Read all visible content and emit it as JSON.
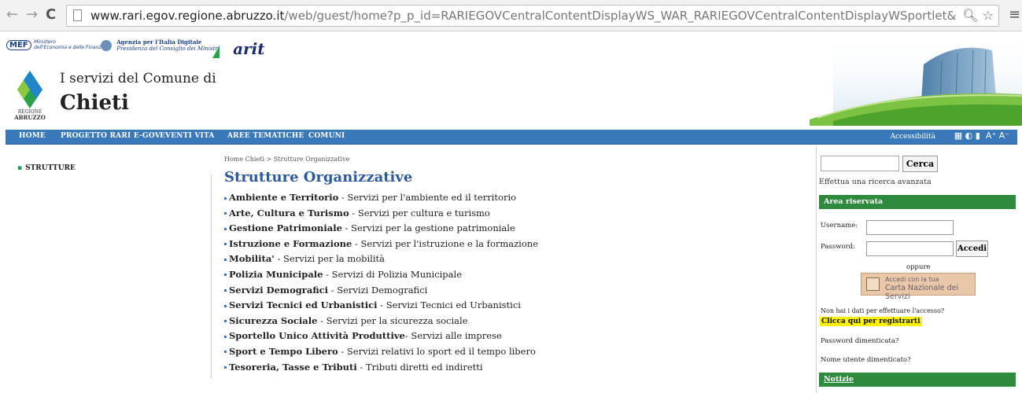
{
  "browser": {
    "url_host": "www.rari.egov.regione.abruzzo.it",
    "url_rest": "/web/guest/home?p_p_id=RARIEGOVCentralContentDisplayWS_WAR_RARIEGOVCentralContentDisplayWSportlet&p_p_life"
  },
  "logos": {
    "mef": "MEF",
    "mef_text_1": "Ministero",
    "mef_text_2": "dell'Economia e delle Finanze",
    "agid_1": "Agenzia per l'Italia Digitale",
    "agid_2": "Presidenza del Consiglio dei Ministri",
    "arit": "arit",
    "region_1": "REGIONE",
    "region_2": "ABRUZZO"
  },
  "header": {
    "subtitle": "I servizi del Comune di",
    "title": "Chieti"
  },
  "nav": {
    "items": [
      "HOME",
      "PROGETTO RARI E-GOV",
      "EVENTI VITA",
      "AREE TEMATICHE",
      "COMUNI"
    ],
    "accessibility": "Accessibilità",
    "font_tools": "A⁺ A⁻"
  },
  "sidebar": {
    "item": "STRUTTURE"
  },
  "breadcrumb": "Home Chieti  >  Strutture Organizzative",
  "main": {
    "title": "Strutture Organizzative",
    "categories": [
      {
        "name": "Ambiente e Territorio",
        "desc": " - Servizi per l'ambiente ed il territorio"
      },
      {
        "name": "Arte, Cultura e Turismo",
        "desc": " - Servizi per cultura e turismo"
      },
      {
        "name": "Gestione Patrimoniale",
        "desc": " - Servizi per la gestione patrimoniale"
      },
      {
        "name": "Istruzione e Formazione",
        "desc": " - Servizi per l'istruzione e la formazione"
      },
      {
        "name": "Mobilita'",
        "desc": " - Servizi per la mobilità"
      },
      {
        "name": "Polizia Municipale",
        "desc": " - Servizi di Polizia Municipale"
      },
      {
        "name": "Servizi Demografici",
        "desc": " - Servizi Demografici"
      },
      {
        "name": "Servizi Tecnici ed Urbanistici",
        "desc": " - Servizi Tecnici ed Urbanistici"
      },
      {
        "name": "Sicurezza Sociale",
        "desc": " - Servizi per la sicurezza sociale"
      },
      {
        "name": "Sportello Unico Attività Produttive",
        "desc": "- Servizi alle imprese"
      },
      {
        "name": "Sport e Tempo Libero",
        "desc": " - Servizi relativi lo sport ed il tempo libero"
      },
      {
        "name": "Tesoreria, Tasse e Tributi",
        "desc": " - Tributi diretti ed indiretti"
      }
    ]
  },
  "search": {
    "button": "Cerca",
    "advanced": "Effettua una ricerca avanzata"
  },
  "login": {
    "header": "Area riservata",
    "username_label": "Username:",
    "password_label": "Password:",
    "submit": "Accedi",
    "or": "oppure",
    "cns_1": "Accedi con la tua",
    "cns_2": "Carta Nazionale dei Servizi",
    "no_data": "Non hai i dati per effettuare l'accesso?",
    "register": "Clicca qui per registrarti",
    "forgot_password": "Password dimenticata?",
    "forgot_username": "Nome utente dimenticato?"
  },
  "news": {
    "header": "Notizie"
  },
  "colors": {
    "nav_blue": "#3a79b9",
    "panel_green": "#2e8b3e",
    "title_blue": "#2d5a9a",
    "highlight": "#fff200"
  }
}
